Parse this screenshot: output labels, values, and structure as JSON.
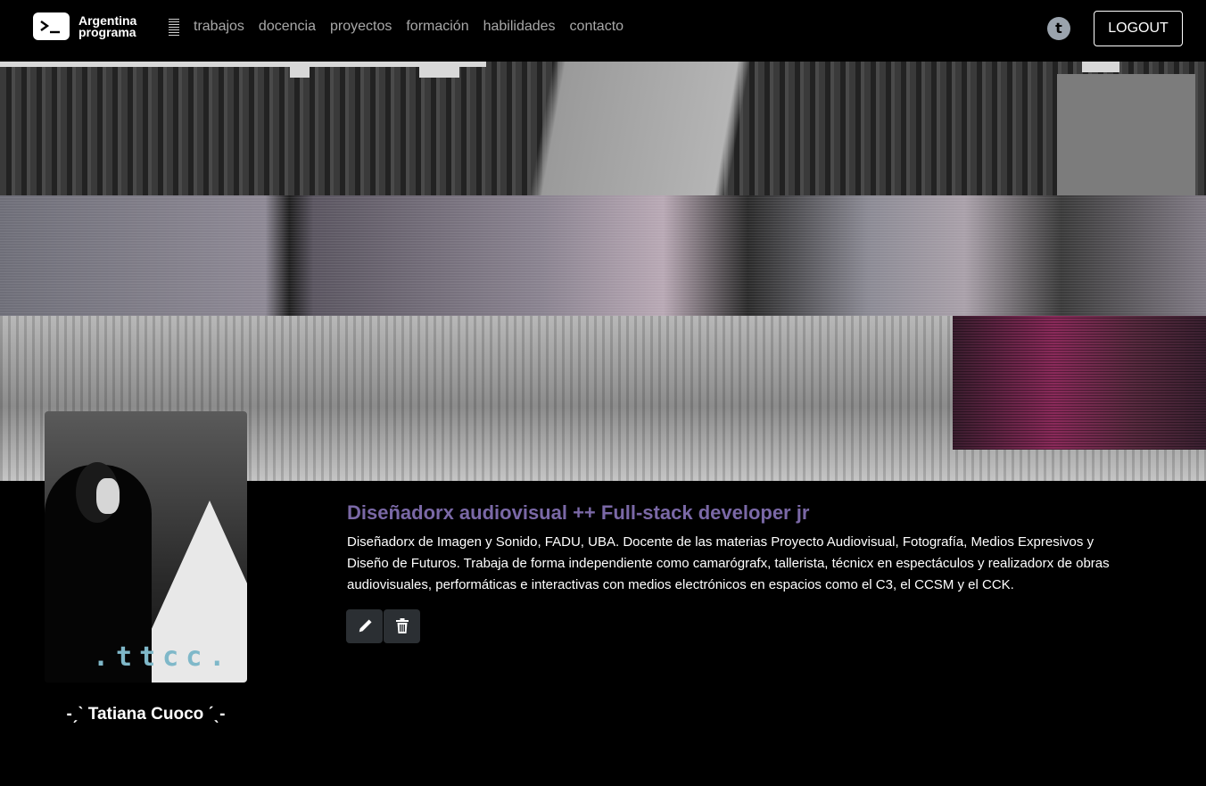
{
  "brand": {
    "line1": "Argentina",
    "line2": "programa"
  },
  "nav": {
    "items": [
      {
        "label": "trabajos"
      },
      {
        "label": "docencia"
      },
      {
        "label": "proyectos"
      },
      {
        "label": "formación"
      },
      {
        "label": "habilidades"
      },
      {
        "label": "contacto"
      }
    ],
    "social_icon": "t",
    "logout_label": "LOGOUT"
  },
  "profile": {
    "photo_caption": ".ttcc.",
    "name": "-ˏˋ Tatiana Cuoco ˊˎ-",
    "headline": "Diseñadorx audiovisual ++ Full-stack developer jr",
    "description": "Diseñadorx de Imagen y Sonido, FADU, UBA. Docente de las materias Proyecto Audiovisual, Fotografía, Medios Expresivos y Diseño de Futuros. Trabaja de forma independiente como camarógrafx, tallerista, técnicx en espectáculos y realizadorx de obras audiovisuales, performáticas e interactivas con medios electrónicos en espacios como el C3, el CCSM y el CCK."
  },
  "icons": {
    "edit": "pencil-icon",
    "delete": "trash-icon"
  },
  "colors": {
    "background": "#000000",
    "headline": "#7a68a6",
    "caption": "#7fb8c9",
    "button": "#2b2f33"
  }
}
